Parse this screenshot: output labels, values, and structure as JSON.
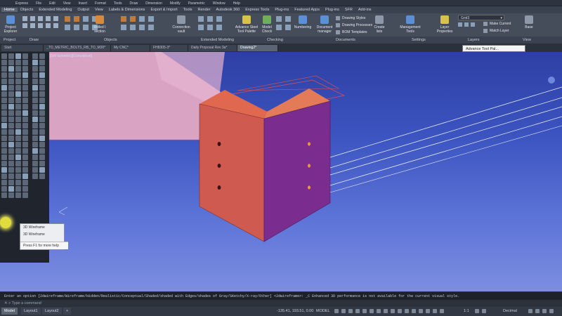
{
  "menu": {
    "items": [
      "Express",
      "File",
      "Edit",
      "View",
      "Insert",
      "Format",
      "Tools",
      "Draw",
      "Dimension",
      "Modify",
      "Parametric",
      "Window",
      "Help"
    ]
  },
  "ribbon_tabs": {
    "items": [
      "Home",
      "Objects",
      "Extended Modeling",
      "Output",
      "View",
      "Labels & Dimensions",
      "Export & Import",
      "Tools",
      "Render",
      "Autodesk 360",
      "Express Tools",
      "Plug-ins",
      "Featured Apps",
      "Plug-ins",
      "SFR",
      "Add-ins"
    ]
  },
  "ribbon": {
    "project_explorer": "Project Explorer",
    "rolled_section": "Rolled I section",
    "connection_vault": "Connection vault",
    "advance_steel_tool_palette": "Advance Steel Tool Palette",
    "model_check": "Model Check",
    "numbering": "Numbering",
    "document_manager": "Document manager",
    "drawing_styles": "Drawing Styles",
    "drawing_processes": "Drawing Processes",
    "bom_templates": "BOM Templates",
    "create_lists": "Create lists",
    "management_tools": "Management Tools",
    "layer_properties": "Layer Properties",
    "layer_name": "Grid3",
    "make_current": "Make Current",
    "match_layer": "Match Layer",
    "base": "Base"
  },
  "panels": {
    "project": "Project",
    "draw": "Draw",
    "objects": "Objects",
    "extended_modeling": "Extended Modeling",
    "checking": "Checking",
    "documents": "Documents",
    "settings": "Settings",
    "layers": "Layers",
    "view": "View"
  },
  "file_tabs": [
    {
      "label": "Start"
    },
    {
      "label": "_TO_METRIC_BOLTS_RB_TO_M30*"
    },
    {
      "label": "My CNC*"
    },
    {
      "label": "FH8305-3*"
    },
    {
      "label": "Daily Proposal Rev 3a*"
    },
    {
      "label": "Drawing2*"
    }
  ],
  "viewport_label": "[-][SW Isometric][Conceptual]",
  "tooltip": "Advance Tool Pal...",
  "flyout": {
    "item1": "3D Wireframe",
    "item2": "3D Wireframe",
    "help": "Press F1 for more help"
  },
  "command": {
    "history": "Enter an option [2dwireframe/Wireframe/Hidden/Realistic/Conceptual/Shaded/shaded with Edges/shades of Gray/SKetchy/X-ray/Other] <2dwireframe>: _C Enhanced 3D performance is not available for the current visual style.",
    "placeholder": "Type a command"
  },
  "status": {
    "tabs": [
      "Model",
      "Layout1",
      "Layout2"
    ],
    "coords": "-135.41, 193.51, 0.00",
    "space": "MODEL",
    "scale": "1:1",
    "units": "Decimal"
  },
  "colors": {
    "viewport_top": "#2d3fa4",
    "viewport_bottom": "#7d8ee0",
    "beam": "#d8a0c0",
    "plate_left": "#cc5a4a",
    "plate_right": "#7a3090"
  }
}
